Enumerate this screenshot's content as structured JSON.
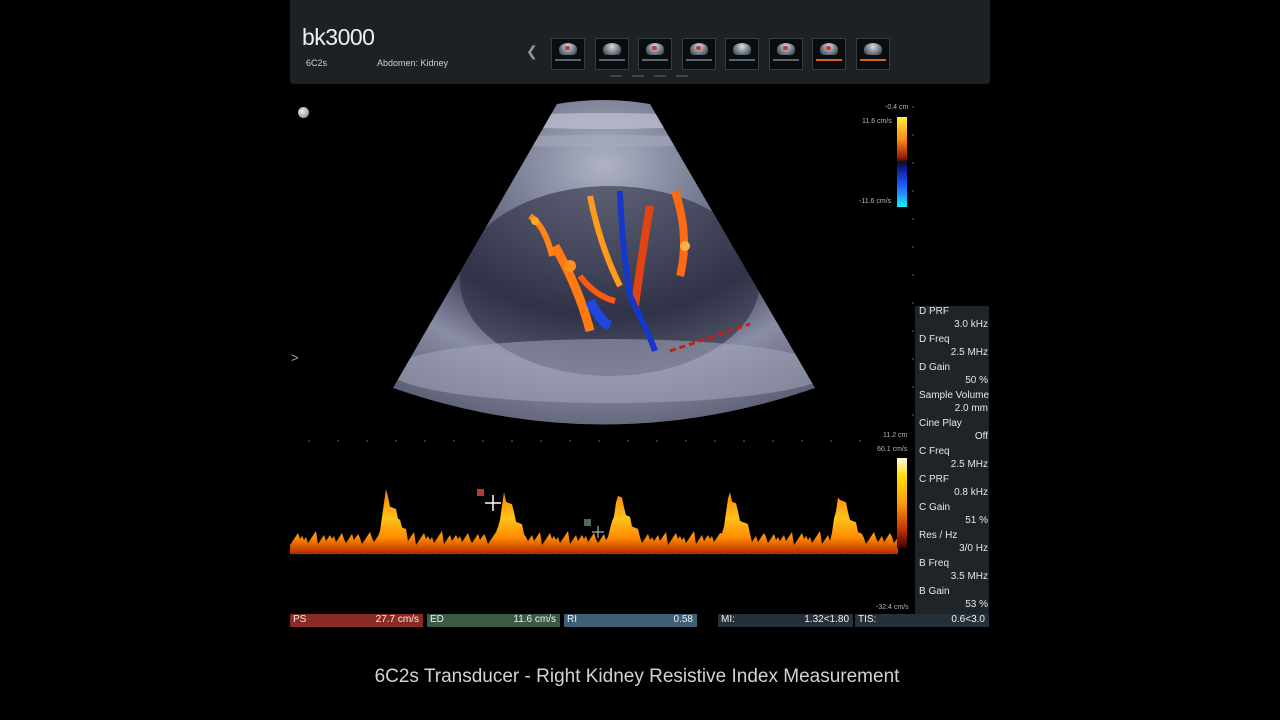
{
  "header": {
    "brand": "bk3000",
    "probe": "6C2s",
    "preset": "Abdomen: Kidney",
    "prev_icon": "chevron-left-icon",
    "thumbnail_count": 8
  },
  "imaging": {
    "depth_top": "-0.4 cm",
    "velocity_top": "11.6 cm/s",
    "velocity_bottom": "-11.6 cm/s",
    "depth_bottom": "11.2 cm",
    "spectral_top": "60.1 cm/s",
    "spectral_bottom": "-32.4 cm/s",
    "focus_marker": ">"
  },
  "panel": {
    "items": [
      {
        "label": "D PRF",
        "value": "3.0 kHz"
      },
      {
        "label": "D Freq",
        "value": "2.5 MHz"
      },
      {
        "label": "D Gain",
        "value": "50 %"
      },
      {
        "label": "Sample Volume",
        "value": "2.0 mm"
      },
      {
        "label": "Cine Play",
        "value": "Off"
      },
      {
        "label": "C Freq",
        "value": "2.5 MHz"
      },
      {
        "label": "C PRF",
        "value": "0.8 kHz"
      },
      {
        "label": "C Gain",
        "value": "51 %"
      },
      {
        "label": "Res / Hz",
        "value": "3/0 Hz"
      },
      {
        "label": "B Freq",
        "value": "3.5 MHz"
      },
      {
        "label": "B Gain",
        "value": "53 %"
      }
    ]
  },
  "measurements": {
    "ps_label": "PS",
    "ps_value": "27.7 cm/s",
    "ed_label": "ED",
    "ed_value": "11.6 cm/s",
    "ri_label": "RI",
    "ri_value": "0.58",
    "mi_label": "MI:",
    "mi_value": "1.32<1.80",
    "tis_label": "TIS:",
    "tis_value": "0.6<3.0",
    "colors": {
      "ps": "#8a2a22",
      "ed": "#3a5a44",
      "ri": "#3e5e74",
      "mi": "#263038"
    }
  },
  "caption": "6C2s Transducer - Right Kidney Resistive Index Measurement"
}
